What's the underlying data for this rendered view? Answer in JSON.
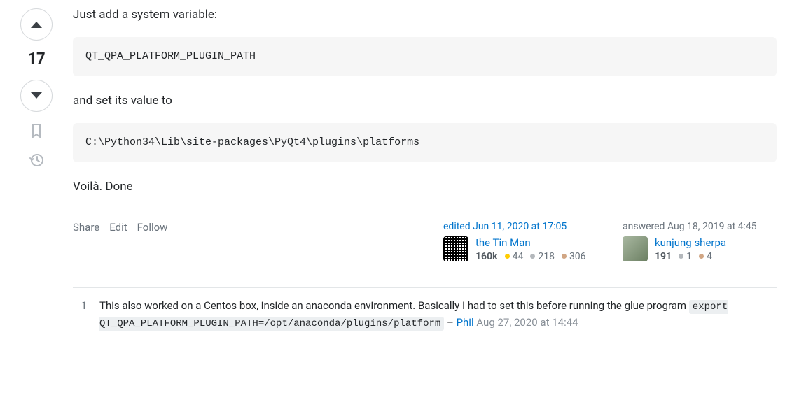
{
  "vote": {
    "score": "17"
  },
  "answer": {
    "p1": "Just add a system variable:",
    "code1": "QT_QPA_PLATFORM_PLUGIN_PATH",
    "p2": "and set its value to",
    "code2": "C:\\Python34\\Lib\\site-packages\\PyQt4\\plugins\\platforms",
    "p3": "Voilà. Done"
  },
  "menu": {
    "share": "Share",
    "edit": "Edit",
    "follow": "Follow"
  },
  "editor": {
    "action_prefix": "edited ",
    "action_time": "Jun 11, 2020 at 17:05",
    "name": "the Tin Man",
    "rep": "160k",
    "gold": "44",
    "silver": "218",
    "bronze": "306"
  },
  "author": {
    "action_prefix": "answered ",
    "action_time": "Aug 18, 2019 at 4:45",
    "name": "kunjung sherpa",
    "rep": "191",
    "silver": "1",
    "bronze": "4"
  },
  "comment": {
    "score": "1",
    "text_before": "This also worked on a Centos box, inside an anaconda environment. Basically I had to set this before running the glue program ",
    "code": "export QT_QPA_PLATFORM_PLUGIN_PATH=/opt/anaconda/plugins/platform",
    "dash": " – ",
    "user": "Phil",
    "space": " ",
    "ts": "Aug 27, 2020 at 14:44"
  }
}
